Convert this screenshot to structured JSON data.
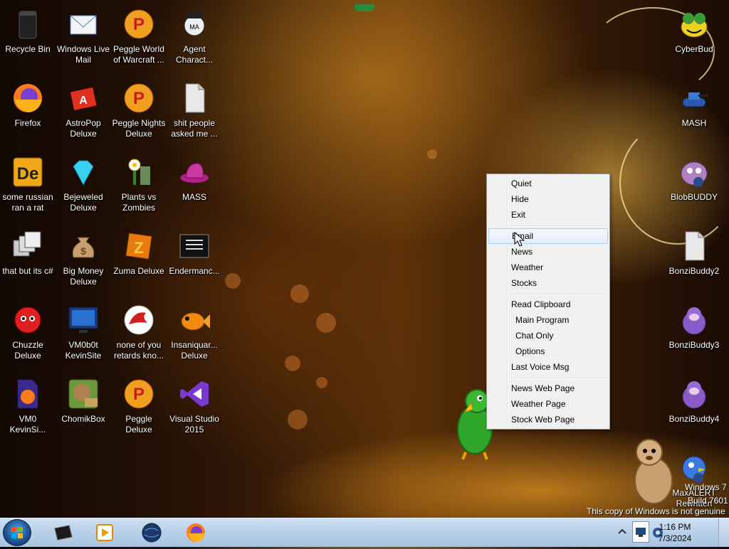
{
  "desktop": {
    "icons_left": [
      {
        "label": "Recycle Bin",
        "icon": "recycle-bin-icon"
      },
      {
        "label": "Windows Live Mail",
        "icon": "mail-icon"
      },
      {
        "label": "Peggle World of Warcraft ...",
        "icon": "peggle-icon"
      },
      {
        "label": "Agent Charact...",
        "icon": "agent-icon"
      },
      {
        "label": "Firefox",
        "icon": "firefox-icon"
      },
      {
        "label": "AstroPop Deluxe",
        "icon": "astropop-icon"
      },
      {
        "label": "Peggle Nights Deluxe",
        "icon": "peggle-icon"
      },
      {
        "label": "shit people asked me ...",
        "icon": "file-icon"
      },
      {
        "label": "some russian ran a rat",
        "icon": "de-icon"
      },
      {
        "label": "Bejeweled Deluxe",
        "icon": "gem-icon"
      },
      {
        "label": "Plants vs Zombies",
        "icon": "plant-icon"
      },
      {
        "label": "MASS",
        "icon": "hat-icon"
      },
      {
        "label": "that but its c#",
        "icon": "window-icon"
      },
      {
        "label": "Big Money Deluxe",
        "icon": "money-bag-icon"
      },
      {
        "label": "Zuma Deluxe",
        "icon": "zuma-icon"
      },
      {
        "label": "Endermanc...",
        "icon": "console-icon"
      },
      {
        "label": "Chuzzle Deluxe",
        "icon": "chuzzle-icon"
      },
      {
        "label": "VM0b0t KevinSite",
        "icon": "monitor-icon"
      },
      {
        "label": "none of you retards kno...",
        "icon": "dragon-icon"
      },
      {
        "label": "Insaniquar... Deluxe",
        "icon": "fish-icon"
      },
      {
        "label": "VM0 KevinSi...",
        "icon": "firefox-file-icon"
      },
      {
        "label": "ChomikBox",
        "icon": "chomikbox-icon"
      },
      {
        "label": "Peggle Deluxe",
        "icon": "peggle-icon"
      },
      {
        "label": "Visual Studio 2015",
        "icon": "visual-studio-icon"
      }
    ],
    "icons_right": [
      {
        "label": "CyberBud",
        "icon": "cyberbud-icon"
      },
      {
        "label": "MASH",
        "icon": "tank-icon"
      },
      {
        "label": "BlobBUDDY",
        "icon": "blob-icon"
      },
      {
        "label": "BonziBuddy2",
        "icon": "file-icon"
      },
      {
        "label": "BonziBuddy3",
        "icon": "gorilla-icon"
      },
      {
        "label": "BonziBuddy4",
        "icon": "gorilla-icon"
      },
      {
        "label": "MaxALERT Rewritten",
        "icon": "bird-icon"
      }
    ],
    "watermark": {
      "line1": "Windows 7",
      "line2": "Build 7601",
      "line3": "This copy of Windows is not genuine"
    }
  },
  "context_menu": {
    "items": [
      {
        "label": "Quiet"
      },
      {
        "label": "Hide"
      },
      {
        "label": "Exit"
      },
      {
        "label": "Email"
      },
      {
        "label": "News"
      },
      {
        "label": "Weather"
      },
      {
        "label": "Stocks"
      },
      {
        "label": "Read Clipboard"
      },
      {
        "label": "Main Program"
      },
      {
        "label": "Chat Only"
      },
      {
        "label": "Options"
      },
      {
        "label": "Last Voice Msg"
      },
      {
        "label": "News Web Page"
      },
      {
        "label": "Weather Page"
      },
      {
        "label": "Stock Web Page"
      }
    ],
    "highlighted": "Email"
  },
  "taskbar": {
    "pinned": [
      "explorer-icon",
      "media-player-icon",
      "globe-icon",
      "firefox-icon"
    ],
    "tray": [
      "show-hidden-icons-icon",
      "network-icon",
      "volume-icon"
    ],
    "clock_time": "1:16 PM",
    "clock_date": "7/3/2024"
  }
}
